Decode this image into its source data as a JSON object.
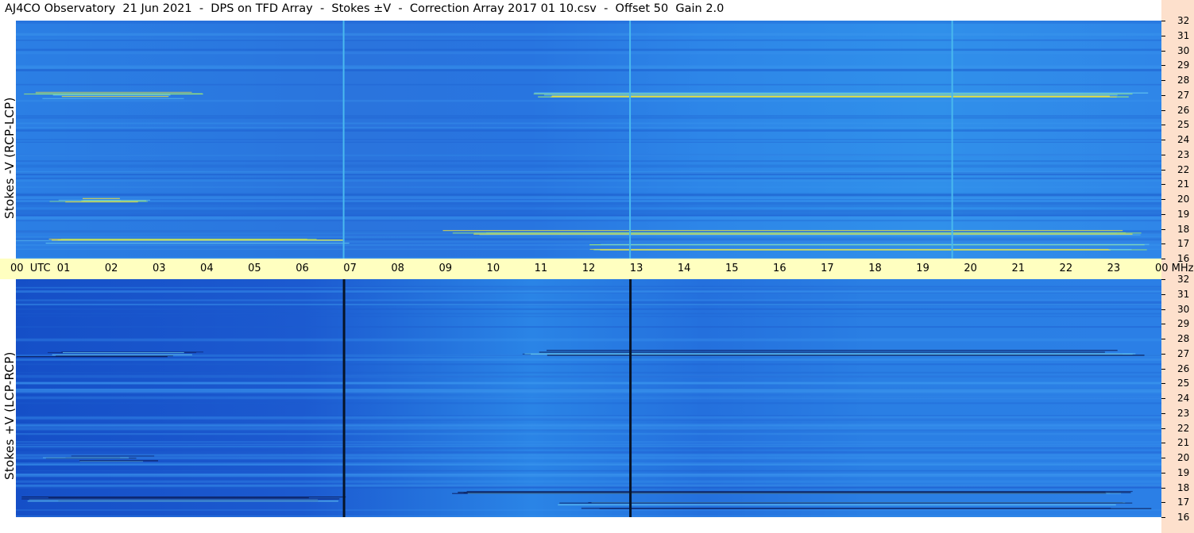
{
  "title": "AJ4CO Observatory  21 Jun 2021  -  DPS on TFD Array  -  Stokes ±V  -  Correction Array 2017 01 10.csv  -  Offset 50  Gain 2.0",
  "chart_data": [
    {
      "type": "heatmap",
      "panel": "top",
      "ylabel": "Stokes -V (RCP-LCP)",
      "x_ticks": [
        "00",
        "01",
        "02",
        "03",
        "04",
        "05",
        "06",
        "07",
        "08",
        "09",
        "10",
        "11",
        "12",
        "13",
        "14",
        "15",
        "16",
        "17",
        "18",
        "19",
        "20",
        "21",
        "22",
        "23",
        "00"
      ],
      "x_unit": "UTC",
      "y_ticks": [
        32,
        31,
        30,
        29,
        28,
        27,
        26,
        25,
        24,
        23,
        22,
        21,
        20,
        19,
        18,
        17,
        16
      ],
      "y_unit": "MHz",
      "ylim": [
        16,
        32
      ],
      "colormap": [
        "#0a1a5c",
        "#1f62d9",
        "#2f86ea",
        "#58b6f0",
        "#9ee873",
        "#f2e23a"
      ],
      "features": [
        {
          "kind": "vertical_line",
          "utc": 6.85,
          "color": "#49b9ee"
        },
        {
          "kind": "vertical_line",
          "utc": 12.85,
          "color": "#49b9ee"
        },
        {
          "kind": "vertical_line",
          "utc": 19.6,
          "color": "#49b9ee"
        },
        {
          "kind": "band",
          "mhz": 27.0,
          "from_utc": 0,
          "to_utc": 4.0
        },
        {
          "kind": "band",
          "mhz": 27.1,
          "from_utc": 10.5,
          "to_utc": 23.8
        },
        {
          "kind": "band",
          "mhz": 20.0,
          "from_utc": 0.5,
          "to_utc": 3.0
        },
        {
          "kind": "band",
          "mhz": 17.2,
          "from_utc": 0,
          "to_utc": 7.0
        },
        {
          "kind": "band",
          "mhz": 17.8,
          "from_utc": 8.9,
          "to_utc": 23.8
        },
        {
          "kind": "band",
          "mhz": 16.8,
          "from_utc": 11.3,
          "to_utc": 23.8
        }
      ]
    },
    {
      "type": "heatmap",
      "panel": "bottom",
      "ylabel": "Stokes +V (LCP-RCP)",
      "x_ticks": [
        "00",
        "01",
        "02",
        "03",
        "04",
        "05",
        "06",
        "07",
        "08",
        "09",
        "10",
        "11",
        "12",
        "13",
        "14",
        "15",
        "16",
        "17",
        "18",
        "19",
        "20",
        "21",
        "22",
        "23",
        "00"
      ],
      "x_unit": "UTC",
      "y_ticks": [
        32,
        31,
        30,
        29,
        28,
        27,
        26,
        25,
        24,
        23,
        22,
        21,
        20,
        19,
        18,
        17,
        16
      ],
      "y_unit": "MHz",
      "ylim": [
        16,
        32
      ],
      "colormap": [
        "#0a1a5c",
        "#1f62d9",
        "#2f86ea",
        "#58b6f0",
        "#9ee873",
        "#f2e23a"
      ],
      "features": [
        {
          "kind": "vertical_line",
          "utc": 6.85,
          "color": "#071428"
        },
        {
          "kind": "vertical_line",
          "utc": 12.85,
          "color": "#071428"
        },
        {
          "kind": "band",
          "mhz": 27.0,
          "from_utc": 0,
          "to_utc": 4.0
        },
        {
          "kind": "band",
          "mhz": 27.1,
          "from_utc": 10.5,
          "to_utc": 23.8
        },
        {
          "kind": "band",
          "mhz": 20.0,
          "from_utc": 0.5,
          "to_utc": 3.0
        },
        {
          "kind": "band",
          "mhz": 17.2,
          "from_utc": 0,
          "to_utc": 7.0
        },
        {
          "kind": "band",
          "mhz": 17.8,
          "from_utc": 8.9,
          "to_utc": 23.8
        },
        {
          "kind": "band",
          "mhz": 16.8,
          "from_utc": 11.3,
          "to_utc": 23.8
        }
      ]
    }
  ],
  "time_axis": {
    "first_label": "00  UTC",
    "labels": [
      "01",
      "02",
      "03",
      "04",
      "05",
      "06",
      "07",
      "08",
      "09",
      "10",
      "11",
      "12",
      "13",
      "14",
      "15",
      "16",
      "17",
      "18",
      "19",
      "20",
      "21",
      "22",
      "23"
    ],
    "last_label": "00 MHz"
  }
}
